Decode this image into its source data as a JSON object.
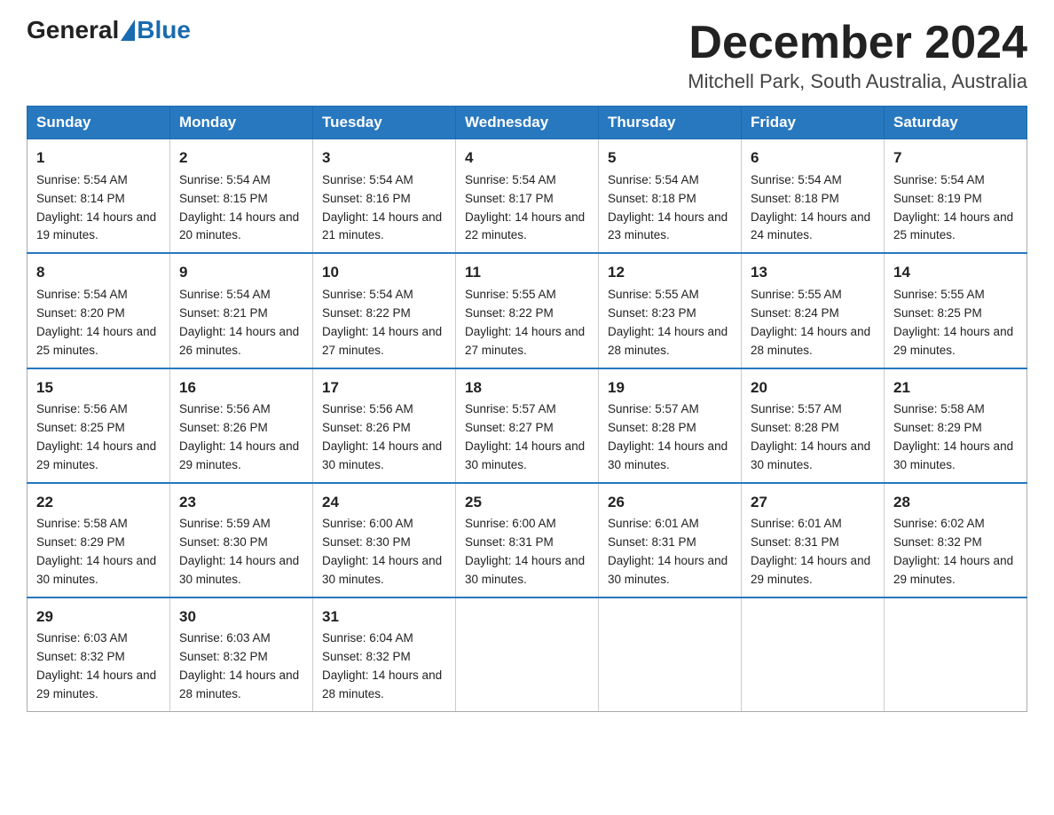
{
  "header": {
    "logo_general": "General",
    "logo_blue": "Blue",
    "month_title": "December 2024",
    "location": "Mitchell Park, South Australia, Australia"
  },
  "days_of_week": [
    "Sunday",
    "Monday",
    "Tuesday",
    "Wednesday",
    "Thursday",
    "Friday",
    "Saturday"
  ],
  "weeks": [
    [
      {
        "day": "1",
        "sunrise": "5:54 AM",
        "sunset": "8:14 PM",
        "daylight": "14 hours and 19 minutes."
      },
      {
        "day": "2",
        "sunrise": "5:54 AM",
        "sunset": "8:15 PM",
        "daylight": "14 hours and 20 minutes."
      },
      {
        "day": "3",
        "sunrise": "5:54 AM",
        "sunset": "8:16 PM",
        "daylight": "14 hours and 21 minutes."
      },
      {
        "day": "4",
        "sunrise": "5:54 AM",
        "sunset": "8:17 PM",
        "daylight": "14 hours and 22 minutes."
      },
      {
        "day": "5",
        "sunrise": "5:54 AM",
        "sunset": "8:18 PM",
        "daylight": "14 hours and 23 minutes."
      },
      {
        "day": "6",
        "sunrise": "5:54 AM",
        "sunset": "8:18 PM",
        "daylight": "14 hours and 24 minutes."
      },
      {
        "day": "7",
        "sunrise": "5:54 AM",
        "sunset": "8:19 PM",
        "daylight": "14 hours and 25 minutes."
      }
    ],
    [
      {
        "day": "8",
        "sunrise": "5:54 AM",
        "sunset": "8:20 PM",
        "daylight": "14 hours and 25 minutes."
      },
      {
        "day": "9",
        "sunrise": "5:54 AM",
        "sunset": "8:21 PM",
        "daylight": "14 hours and 26 minutes."
      },
      {
        "day": "10",
        "sunrise": "5:54 AM",
        "sunset": "8:22 PM",
        "daylight": "14 hours and 27 minutes."
      },
      {
        "day": "11",
        "sunrise": "5:55 AM",
        "sunset": "8:22 PM",
        "daylight": "14 hours and 27 minutes."
      },
      {
        "day": "12",
        "sunrise": "5:55 AM",
        "sunset": "8:23 PM",
        "daylight": "14 hours and 28 minutes."
      },
      {
        "day": "13",
        "sunrise": "5:55 AM",
        "sunset": "8:24 PM",
        "daylight": "14 hours and 28 minutes."
      },
      {
        "day": "14",
        "sunrise": "5:55 AM",
        "sunset": "8:25 PM",
        "daylight": "14 hours and 29 minutes."
      }
    ],
    [
      {
        "day": "15",
        "sunrise": "5:56 AM",
        "sunset": "8:25 PM",
        "daylight": "14 hours and 29 minutes."
      },
      {
        "day": "16",
        "sunrise": "5:56 AM",
        "sunset": "8:26 PM",
        "daylight": "14 hours and 29 minutes."
      },
      {
        "day": "17",
        "sunrise": "5:56 AM",
        "sunset": "8:26 PM",
        "daylight": "14 hours and 30 minutes."
      },
      {
        "day": "18",
        "sunrise": "5:57 AM",
        "sunset": "8:27 PM",
        "daylight": "14 hours and 30 minutes."
      },
      {
        "day": "19",
        "sunrise": "5:57 AM",
        "sunset": "8:28 PM",
        "daylight": "14 hours and 30 minutes."
      },
      {
        "day": "20",
        "sunrise": "5:57 AM",
        "sunset": "8:28 PM",
        "daylight": "14 hours and 30 minutes."
      },
      {
        "day": "21",
        "sunrise": "5:58 AM",
        "sunset": "8:29 PM",
        "daylight": "14 hours and 30 minutes."
      }
    ],
    [
      {
        "day": "22",
        "sunrise": "5:58 AM",
        "sunset": "8:29 PM",
        "daylight": "14 hours and 30 minutes."
      },
      {
        "day": "23",
        "sunrise": "5:59 AM",
        "sunset": "8:30 PM",
        "daylight": "14 hours and 30 minutes."
      },
      {
        "day": "24",
        "sunrise": "6:00 AM",
        "sunset": "8:30 PM",
        "daylight": "14 hours and 30 minutes."
      },
      {
        "day": "25",
        "sunrise": "6:00 AM",
        "sunset": "8:31 PM",
        "daylight": "14 hours and 30 minutes."
      },
      {
        "day": "26",
        "sunrise": "6:01 AM",
        "sunset": "8:31 PM",
        "daylight": "14 hours and 30 minutes."
      },
      {
        "day": "27",
        "sunrise": "6:01 AM",
        "sunset": "8:31 PM",
        "daylight": "14 hours and 29 minutes."
      },
      {
        "day": "28",
        "sunrise": "6:02 AM",
        "sunset": "8:32 PM",
        "daylight": "14 hours and 29 minutes."
      }
    ],
    [
      {
        "day": "29",
        "sunrise": "6:03 AM",
        "sunset": "8:32 PM",
        "daylight": "14 hours and 29 minutes."
      },
      {
        "day": "30",
        "sunrise": "6:03 AM",
        "sunset": "8:32 PM",
        "daylight": "14 hours and 28 minutes."
      },
      {
        "day": "31",
        "sunrise": "6:04 AM",
        "sunset": "8:32 PM",
        "daylight": "14 hours and 28 minutes."
      },
      null,
      null,
      null,
      null
    ]
  ]
}
